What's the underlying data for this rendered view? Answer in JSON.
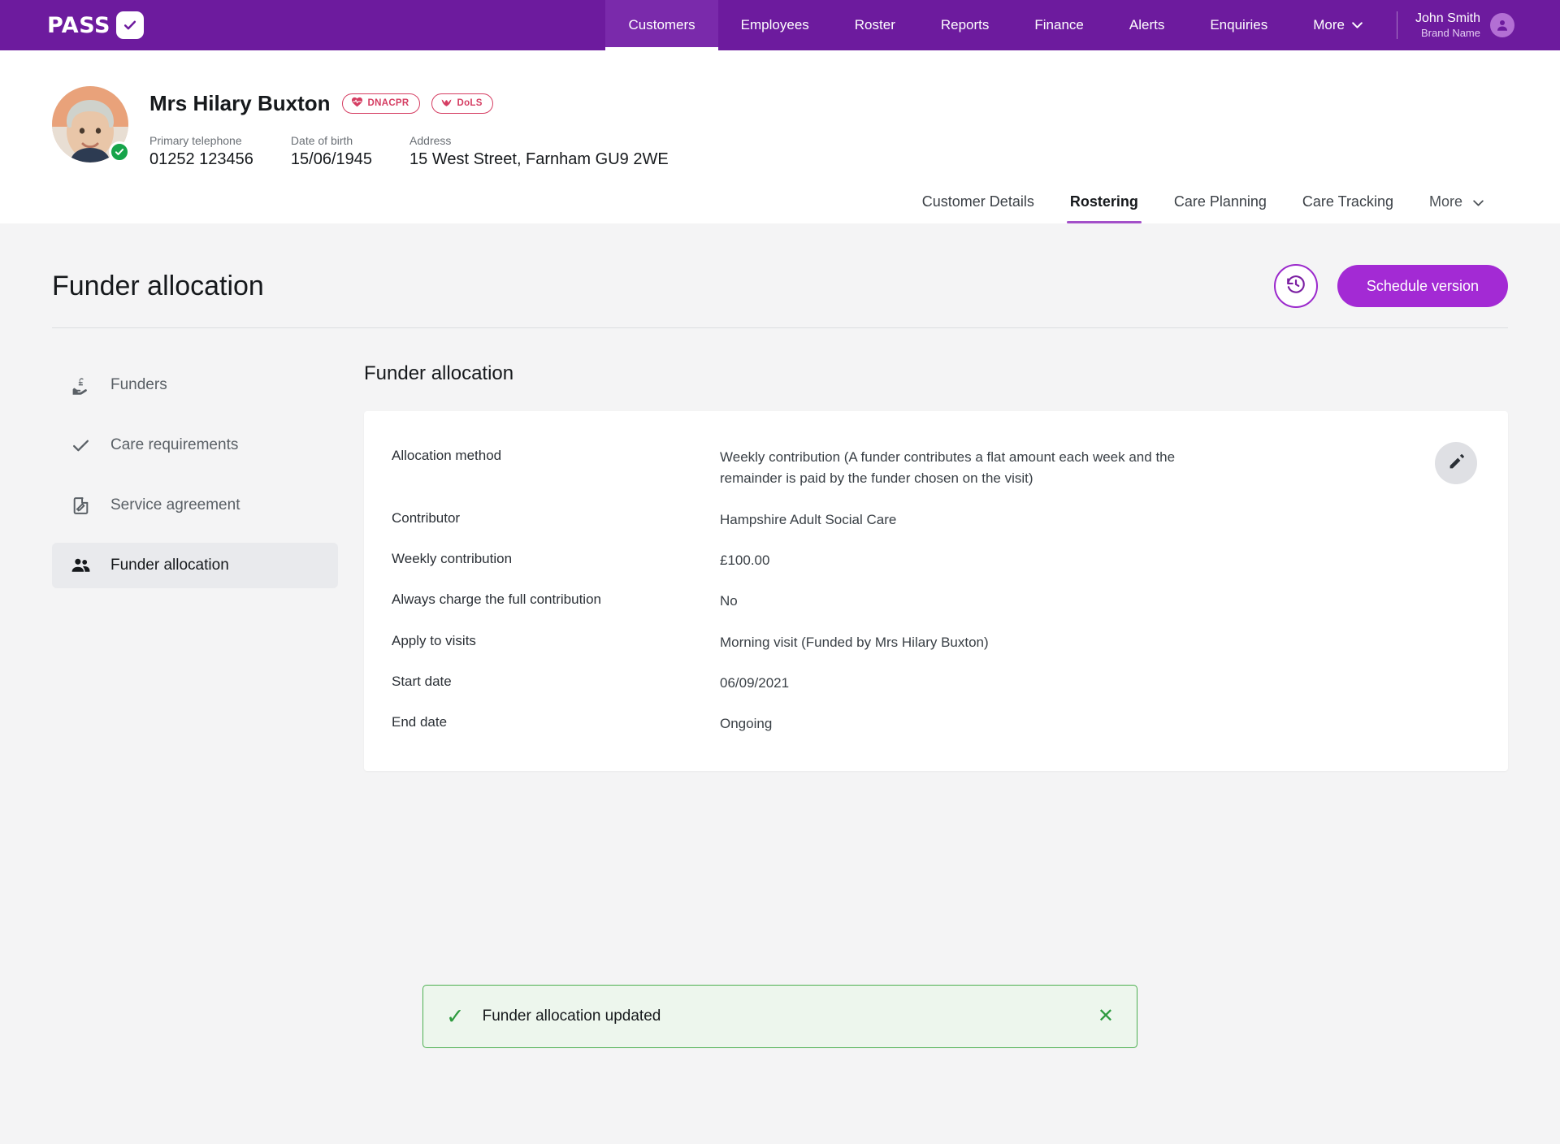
{
  "topnav": {
    "brand_word": "PASS",
    "brand_check_icon": "check-icon",
    "items": [
      {
        "label": "Customers",
        "active": true
      },
      {
        "label": "Employees",
        "active": false
      },
      {
        "label": "Roster",
        "active": false
      },
      {
        "label": "Reports",
        "active": false
      },
      {
        "label": "Finance",
        "active": false
      },
      {
        "label": "Alerts",
        "active": false
      },
      {
        "label": "Enquiries",
        "active": false
      }
    ],
    "more_label": "More",
    "more_caret": "⌄",
    "user": {
      "name": "John Smith",
      "brand": "Brand Name",
      "avatar_icon": "user-avatar-icon"
    },
    "accent_purple": "#6d1b9e"
  },
  "customer": {
    "name": "Mrs Hilary Buxton",
    "avatar_icon": "customer-photo",
    "verified_icon": "verified-check-icon",
    "pills": [
      {
        "label": "DNACPR",
        "icon": "heart-pulse-icon",
        "color": "#d53d62"
      },
      {
        "label": "DoLS",
        "icon": "bird-icon",
        "color": "#d53d62"
      }
    ],
    "meta": [
      {
        "label": "Primary telephone",
        "value": "01252 123456"
      },
      {
        "label": "Date of birth",
        "value": "15/06/1945"
      },
      {
        "label": "Address",
        "value": "15 West Street, Farnham GU9 2WE"
      }
    ],
    "subtabs": [
      {
        "label": "Customer Details",
        "active": false
      },
      {
        "label": "Rostering",
        "active": true
      },
      {
        "label": "Care Planning",
        "active": false
      },
      {
        "label": "Care Tracking",
        "active": false
      }
    ],
    "subtab_more": "More",
    "subtab_more_caret": "⌄"
  },
  "page": {
    "title": "Funder allocation",
    "history_button_icon": "history-clock-icon",
    "schedule_button_label": "Schedule version",
    "schedule_button_color": "#a32ad4"
  },
  "sidebar": {
    "items": [
      {
        "label": "Funders",
        "icon": "pound-hand-icon",
        "active": false
      },
      {
        "label": "Care requirements",
        "icon": "check-icon",
        "active": false
      },
      {
        "label": "Service agreement",
        "icon": "document-edit-icon",
        "active": false
      },
      {
        "label": "Funder allocation",
        "icon": "people-icon",
        "active": true
      }
    ]
  },
  "card": {
    "heading": "Funder allocation",
    "edit_icon": "pencil-icon",
    "rows": [
      {
        "label": "Allocation method",
        "value": "Weekly contribution (A funder contributes a flat amount each week and the remainder is paid by the funder chosen on the visit)"
      },
      {
        "label": "Contributor",
        "value": "Hampshire Adult Social Care"
      },
      {
        "label": "Weekly contribution",
        "value": "£100.00"
      },
      {
        "label": "Always charge the full contribution",
        "value": "No"
      },
      {
        "label": "Apply to visits",
        "value": "Morning visit (Funded by Mrs Hilary Buxton)"
      },
      {
        "label": "Start date",
        "value": "06/09/2021"
      },
      {
        "label": "End date",
        "value": "Ongoing"
      }
    ]
  },
  "toast": {
    "message": "Funder allocation updated",
    "check_icon": "check-icon",
    "close_icon": "close-icon",
    "close_label": "✕",
    "check_glyph": "✓",
    "color": "#4caf50"
  }
}
